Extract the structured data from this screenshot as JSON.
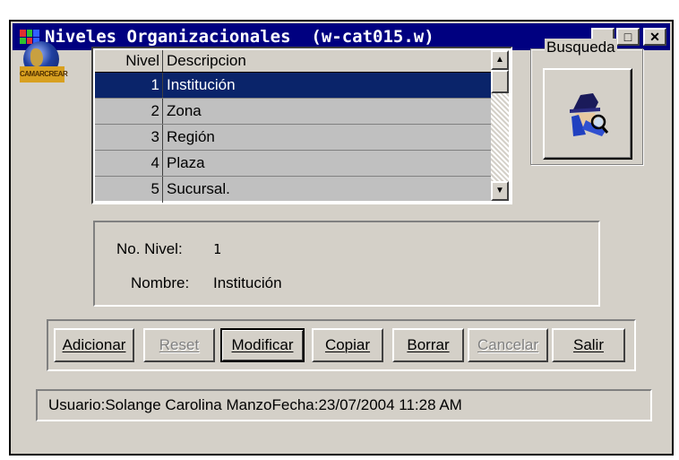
{
  "window": {
    "title": "Niveles Organizacionales  (w-cat015.w)",
    "controls": {
      "minimize": "_",
      "maximize": "□",
      "close": "✕"
    }
  },
  "logo": {
    "text": "CAMARCREAR"
  },
  "grid": {
    "headers": {
      "nivel": "Nivel",
      "descripcion": "Descripcion"
    },
    "rows": [
      {
        "nivel": "1",
        "descripcion": "Institución"
      },
      {
        "nivel": "2",
        "descripcion": "Zona"
      },
      {
        "nivel": "3",
        "descripcion": "Región"
      },
      {
        "nivel": "4",
        "descripcion": "Plaza"
      },
      {
        "nivel": "5",
        "descripcion": "Sucursal."
      }
    ],
    "selected_row": 0,
    "scroll_up": "▲",
    "scroll_down": "▼"
  },
  "search": {
    "label": "Busqueda",
    "icon": "detective-icon"
  },
  "detail": {
    "nivel_label": "No. Nivel:",
    "nivel_value": "1",
    "nombre_label": "Nombre:",
    "nombre_value": "Institución"
  },
  "buttons": {
    "adicionar": "Adicionar",
    "reset": "Reset",
    "modificar": "Modificar",
    "copiar": "Copiar",
    "borrar": "Borrar",
    "cancelar": "Cancelar",
    "salir": "Salir"
  },
  "status": {
    "usuario_label": "Usuario:",
    "usuario": "Solange Carolina Manzo",
    "fecha_label": "Fecha:",
    "fecha": "23/07/2004 11:28 AM"
  },
  "colors": {
    "selection": "#0a246a",
    "titlebar": "#000080",
    "face": "#d4d0c8"
  }
}
